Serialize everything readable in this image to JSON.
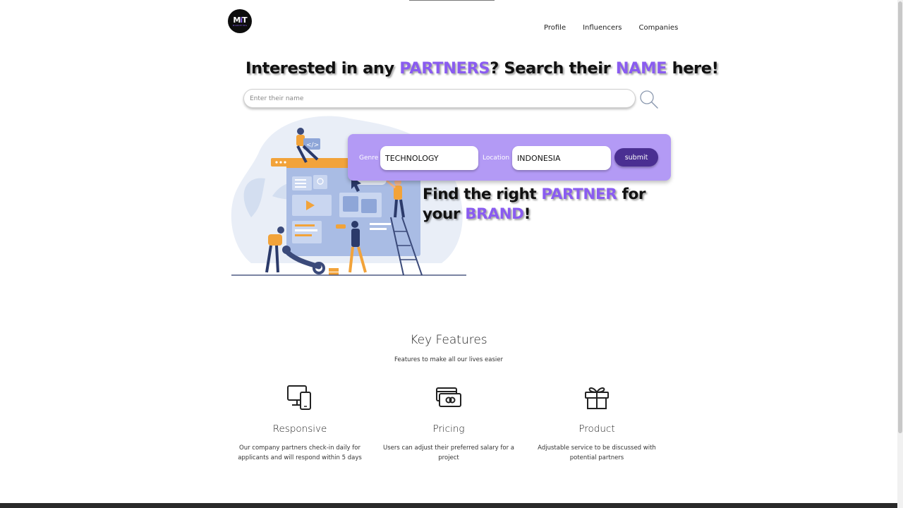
{
  "header": {
    "logo_text": "MiT",
    "logo_sub": "MARKETING",
    "nav": [
      "Profile",
      "Influencers",
      "Companies"
    ]
  },
  "hero": {
    "title_part1": "Interested in any ",
    "title_accent1": "PARTNERS",
    "title_part2": "? Search their ",
    "title_accent2": "NAME",
    "title_part3": " here!",
    "search_placeholder": "Enter their name"
  },
  "filter": {
    "genre_label": "Genre",
    "genre_value": "TECHNOLOGY",
    "location_label": "Location",
    "location_value": "INDONESIA",
    "submit_label": "submit"
  },
  "tagline": {
    "part1": "Find the right ",
    "accent1": "PARTNER",
    "part2": " for your ",
    "accent2": "BRAND",
    "part3": "!"
  },
  "features": {
    "title": "Key Features",
    "subtitle": "Features to make all our lives easier",
    "items": [
      {
        "icon": "devices-icon",
        "title": "Responsive",
        "desc": "Our company partners check-in daily for applicants and will respond within 5 days"
      },
      {
        "icon": "pricing-icon",
        "title": "Pricing",
        "desc": "Users can adjust their preferred salary for a project"
      },
      {
        "icon": "gift-icon",
        "title": "Product",
        "desc": "Adjustable service to be discussed with potential partners"
      }
    ]
  },
  "colors": {
    "accent": "#8a5cf0",
    "panel": "#b39af5",
    "button": "#4a2f92"
  }
}
